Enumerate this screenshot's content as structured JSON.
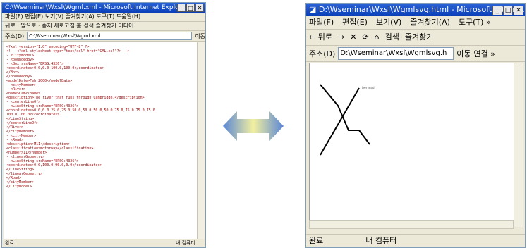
{
  "left_window": {
    "title": "C:\\Wseminar\\Wxsl\\Wgml.xml - Microsoft Internet Explorer",
    "menu": "파일(F) 편집(E) 보기(V) 즐겨찾기(A) 도구(T) 도움말(H)",
    "toolbar": "뒤로 · 앞으로 · 중지 새로고침 홈 검색 즐겨찾기 미디어",
    "address_label": "주소(D)",
    "address_value": "C:\\Wseminar\\Wxsl\\Wgml.xml",
    "go_label": "이동",
    "status": "완료",
    "status_right": "내 컴퓨터",
    "xml_lines": [
      "<?xml version=\"1.0\" encoding=\"UTF-8\" ?>",
      "<!-- <?xml-stylesheet type=\"text/xsl\" href=\"GML.xsl\"?> -->",
      "- <CityModel>",
      "  - <boundedBy>",
      "    - <Box srsName=\"EPSG:4326\">",
      "        <coordinates>0.0,0.0 100.0,100.0</coordinates>",
      "      </Box>",
      "    </boundedBy>",
      "    <modelDate>Feb 2000</modelDate>",
      "  - <cityMember>",
      "    - <River>",
      "        <name>Cam</name>",
      "        <description>The river that runs through Cambridge.</description>",
      "      - <centerLineOf>",
      "        - <LineString srsName=\"EPSG:4326\">",
      "            <coordinates>0.0,0.0 25.0,25.0 50.0,50.0 50.0,50.0 75.0,75.0 75.0,75.0",
      "              100.0,100.0</coordinates>",
      "          </LineString>",
      "        </centerLineOf>",
      "      </River>",
      "    </cityMember>",
      "  - <cityMember>",
      "    - <Road>",
      "        <description>M11</description>",
      "        <classification>motorway</classification>",
      "        <number>11</number>",
      "      - <linearGeometry>",
      "        - <LineString srsName=\"EPSG:4326\">",
      "            <coordinates>0.0,100.0 90.0,0.0</coordinates>",
      "          </LineString>",
      "        </linearGeometry>",
      "      </Road>",
      "    </cityMember>",
      "  </CityModel>"
    ]
  },
  "arrow": {
    "color_mid": "#f2f0a0",
    "color_end": "#5a86d6"
  },
  "right_window": {
    "title": "D:\\Wseminar\\Wxsl\\Wgmlsvg.html - Microsoft Intern...",
    "menu": [
      "파일(F)",
      "편집(E)",
      "보기(V)",
      "즐겨찾기(A)",
      "도구(T) »"
    ],
    "toolbar": [
      "← 뒤로",
      "→",
      "✕",
      "⟳",
      "⌂",
      "검색",
      "즐겨찾기"
    ],
    "address_label": "주소(D)",
    "address_value": "D:\\Wseminar\\Wxsl\\Wgmlsvg.h",
    "go_label": "이동",
    "links_label": "연결 »",
    "svg_label": "river road",
    "status": "완료",
    "status_right": "내 컴퓨터"
  }
}
